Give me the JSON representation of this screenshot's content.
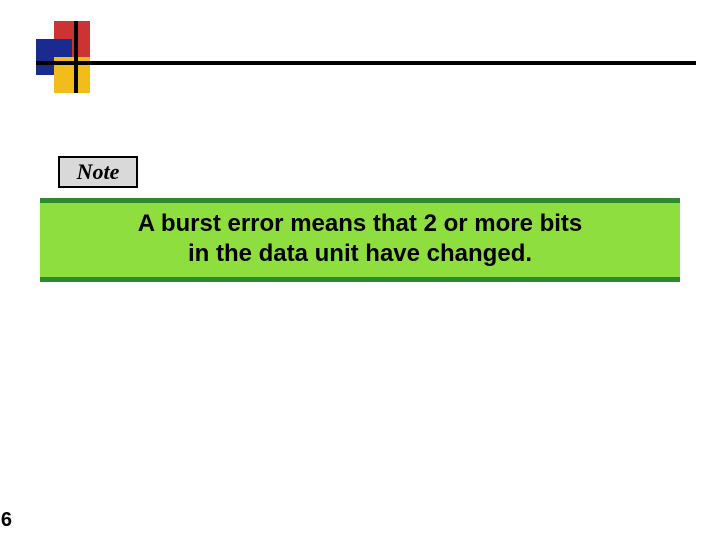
{
  "header": {
    "decor": {
      "colors": {
        "red": "#cc3333",
        "blue": "#1a2a8f",
        "yellow": "#f2bc1a"
      }
    }
  },
  "note": {
    "label": "Note"
  },
  "body": {
    "line1": "A burst error means that 2 or more bits",
    "line2": "in the data unit have changed."
  },
  "page_number": "6"
}
